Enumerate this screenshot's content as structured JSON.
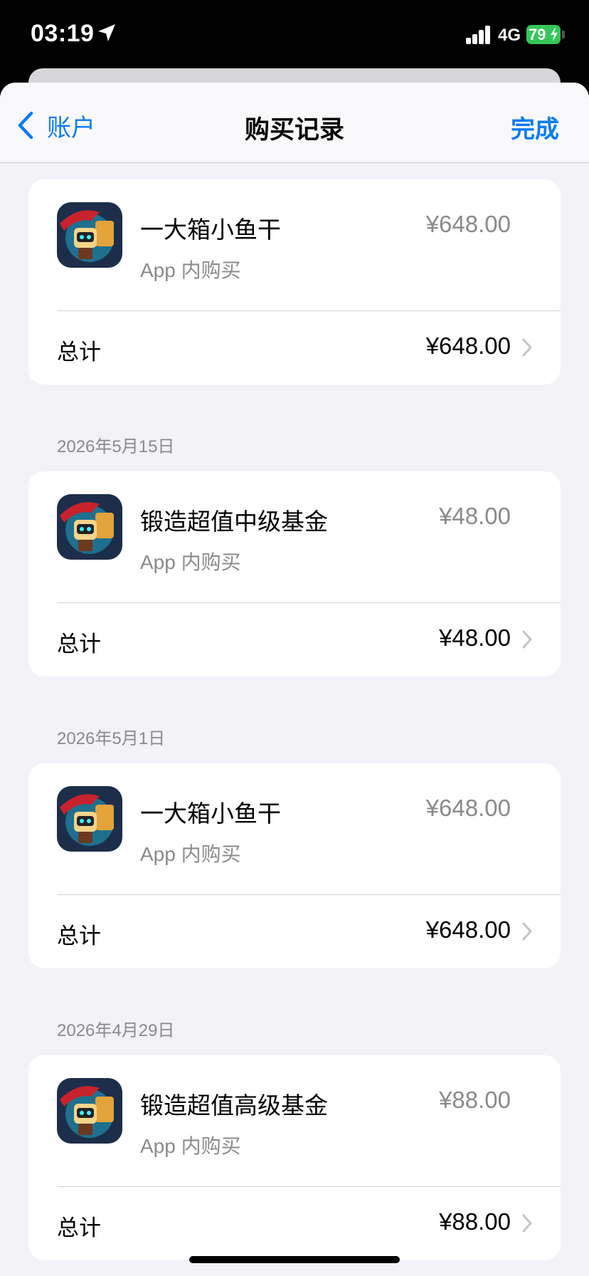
{
  "status_bar": {
    "time": "03:19",
    "network": "4G",
    "battery": "79",
    "location_icon": "location-arrow-icon",
    "signal_icon": "cellular-signal-icon",
    "charging_icon": "charging-bolt-icon"
  },
  "nav": {
    "back_label": "账户",
    "title": "购买记录",
    "done_label": "完成",
    "back_icon": "chevron-left-icon"
  },
  "colors": {
    "accent": "#0a7bf5",
    "battery": "#34c759",
    "background": "#f2f2f7"
  },
  "sections": [
    {
      "date": "",
      "item": {
        "name": "一大箱小鱼干",
        "type": "App 内购买",
        "price": "¥648.00",
        "icon": "game-app-icon"
      },
      "total_label": "总计",
      "total": "¥648.00"
    },
    {
      "date": "2026年5月15日",
      "item": {
        "name": "锻造超值中级基金",
        "type": "App 内购买",
        "price": "¥48.00",
        "icon": "game-app-icon"
      },
      "total_label": "总计",
      "total": "¥48.00"
    },
    {
      "date": "2026年5月1日",
      "item": {
        "name": "一大箱小鱼干",
        "type": "App 内购买",
        "price": "¥648.00",
        "icon": "game-app-icon"
      },
      "total_label": "总计",
      "total": "¥648.00"
    },
    {
      "date": "2026年4月29日",
      "item": {
        "name": "锻造超值高级基金",
        "type": "App 内购买",
        "price": "¥88.00",
        "icon": "game-app-icon"
      },
      "total_label": "总计",
      "total": "¥88.00"
    }
  ]
}
